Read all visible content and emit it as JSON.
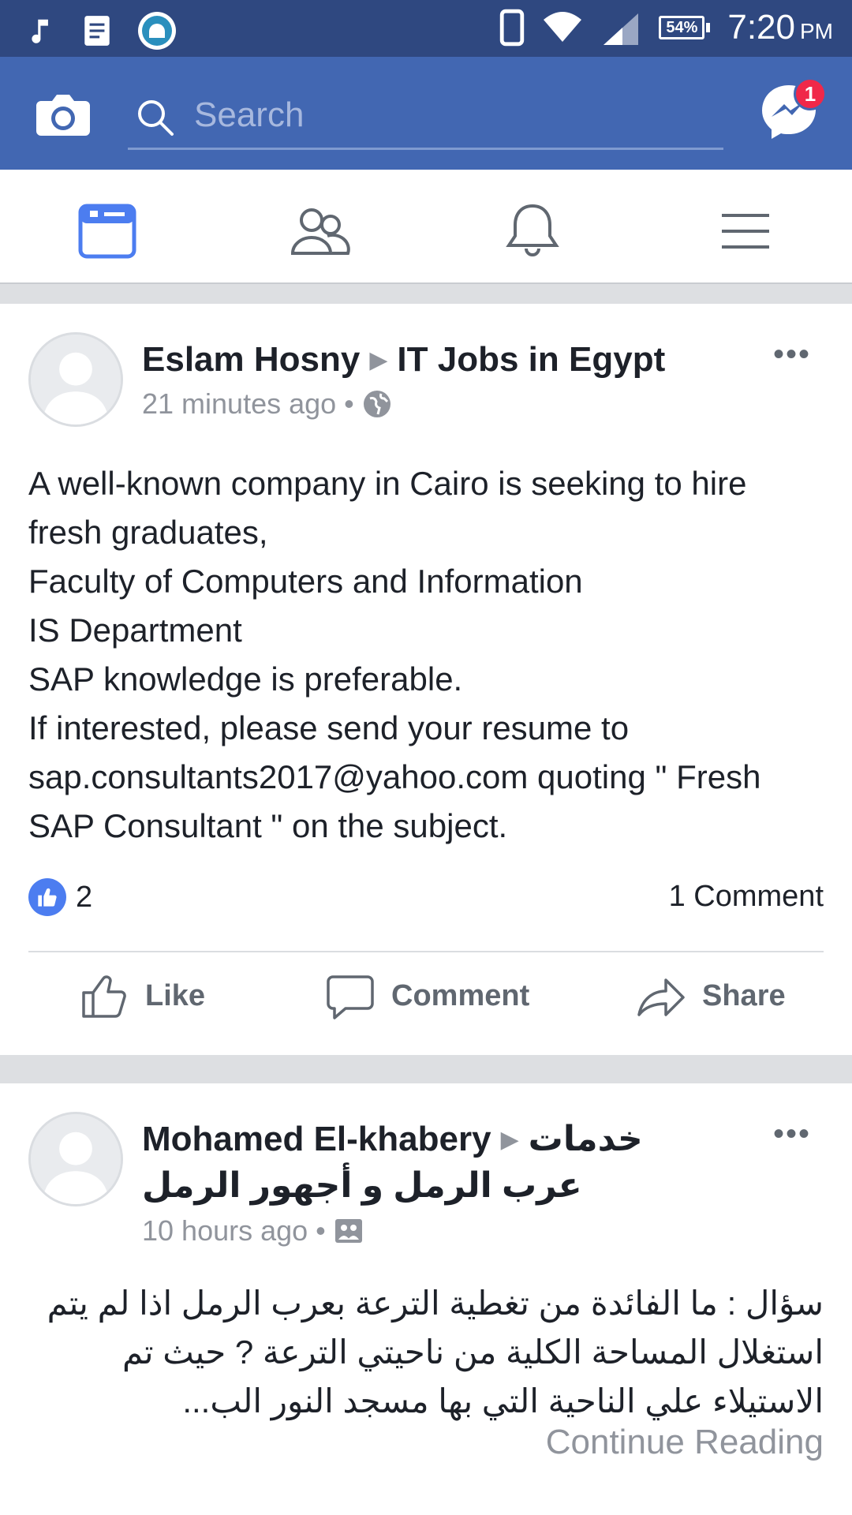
{
  "status_bar": {
    "battery": "54%",
    "time": "7:20",
    "ampm": "PM"
  },
  "search": {
    "placeholder": "Search"
  },
  "messenger": {
    "badge": "1"
  },
  "tabs": [
    {
      "name": "news-feed",
      "active": true
    },
    {
      "name": "friends",
      "active": false
    },
    {
      "name": "notifications",
      "active": false
    },
    {
      "name": "menu",
      "active": false
    }
  ],
  "posts": [
    {
      "author": "Eslam Hosny",
      "target": "IT Jobs in Egypt",
      "time": "21 minutes ago",
      "privacy_icon": "globe-icon",
      "text_lines": [
        "A well-known company in Cairo is seeking to hire fresh graduates,",
        "Faculty of Computers and Information",
        "IS Department",
        "SAP knowledge is preferable.",
        "If interested, please send your resume to sap.consultants2017@yahoo.com quoting \" Fresh SAP Consultant \" on the subject."
      ],
      "likes": "2",
      "comments": "1 Comment",
      "actions": {
        "like": "Like",
        "comment": "Comment",
        "share": "Share"
      }
    },
    {
      "author": "Mohamed El-khabery",
      "target": "خدمات عرب الرمل و أجهور الرمل",
      "time": "10 hours ago",
      "privacy_icon": "group-icon",
      "text": "سؤال : ما الفائدة من تغطية الترعة بعرب الرمل اذا لم يتم استغلال المساحة الكلية من ناحيتي الترعة ? حيث تم الاستيلاء علي الناحية التي بها مسجد النور الب...",
      "continue": "Continue Reading"
    }
  ],
  "colors": {
    "status_bar": "#2f4880",
    "app_bar": "#4267b2",
    "accent": "#4c7df0",
    "badge": "#f02849"
  }
}
